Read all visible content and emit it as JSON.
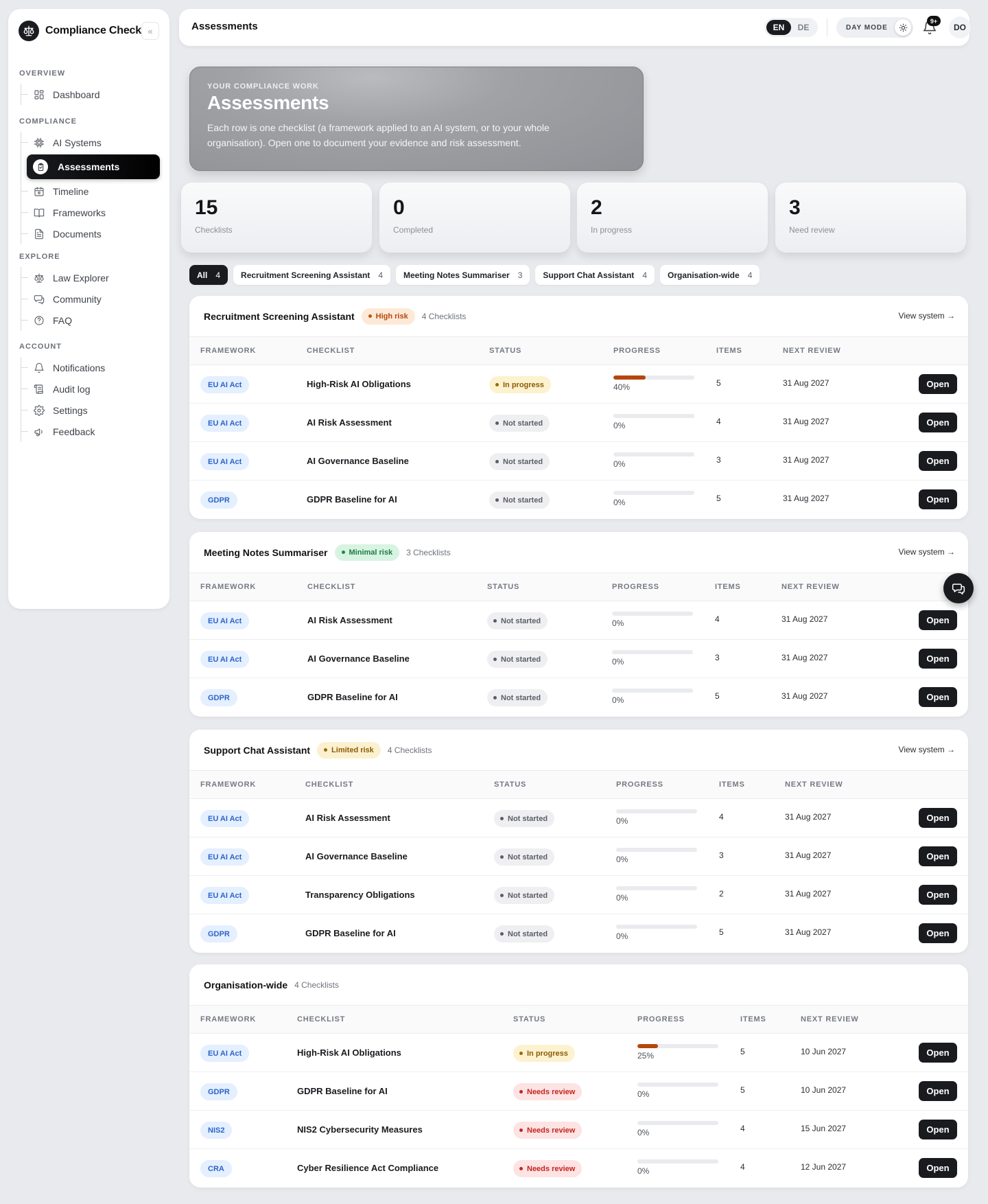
{
  "app": {
    "name": "Compliance Check",
    "collapse_label": "«"
  },
  "nav": {
    "sections": [
      {
        "title": "OVERVIEW",
        "items": [
          {
            "label": "Dashboard",
            "icon": "dashboard-icon"
          }
        ]
      },
      {
        "title": "COMPLIANCE",
        "items": [
          {
            "label": "AI Systems",
            "icon": "chip-icon"
          },
          {
            "label": "Assessments",
            "icon": "clipboard-icon",
            "active": true
          },
          {
            "label": "Timeline",
            "icon": "calendar-icon"
          },
          {
            "label": "Frameworks",
            "icon": "book-icon"
          },
          {
            "label": "Documents",
            "icon": "document-icon"
          }
        ]
      },
      {
        "title": "EXPLORE",
        "items": [
          {
            "label": "Law Explorer",
            "icon": "scales-icon"
          },
          {
            "label": "Community",
            "icon": "chat-icon"
          },
          {
            "label": "FAQ",
            "icon": "help-icon"
          }
        ]
      },
      {
        "title": "ACCOUNT",
        "items": [
          {
            "label": "Notifications",
            "icon": "bell-icon"
          },
          {
            "label": "Audit log",
            "icon": "log-icon"
          },
          {
            "label": "Settings",
            "icon": "gear-icon"
          },
          {
            "label": "Feedback",
            "icon": "megaphone-icon"
          }
        ]
      }
    ]
  },
  "topbar": {
    "title": "Assessments",
    "languages": [
      "EN",
      "DE"
    ],
    "active_language": "EN",
    "mode_label": "DAY MODE",
    "notification_badge": "9+",
    "avatar_initials": "DO"
  },
  "hero": {
    "kicker": "YOUR COMPLIANCE WORK",
    "title": "Assessments",
    "description": "Each row is one checklist (a framework applied to an AI system, or to your whole organisation). Open one to document your evidence and risk assessment."
  },
  "stats": [
    {
      "value": "15",
      "label": "Checklists"
    },
    {
      "value": "0",
      "label": "Completed"
    },
    {
      "value": "2",
      "label": "In progress"
    },
    {
      "value": "3",
      "label": "Need review"
    }
  ],
  "filters": [
    {
      "label": "All",
      "count": "4",
      "active": true
    },
    {
      "label": "Recruitment Screening Assistant",
      "count": "4"
    },
    {
      "label": "Meeting Notes Summariser",
      "count": "3"
    },
    {
      "label": "Support Chat Assistant",
      "count": "4"
    },
    {
      "label": "Organisation-wide",
      "count": "4"
    }
  ],
  "table_headers": {
    "framework": "FRAMEWORK",
    "checklist": "CHECKLIST",
    "status": "STATUS",
    "progress": "PROGRESS",
    "items": "ITEMS",
    "next_review": "NEXT REVIEW"
  },
  "open_label": "Open",
  "view_system_label": "View system →",
  "groups": [
    {
      "name": "Recruitment Screening Assistant",
      "risk": "High risk",
      "risk_level": "high",
      "count": "4 Checklists",
      "view_link": true,
      "rows": [
        {
          "framework": "EU AI Act",
          "checklist": "High-Risk AI Obligations",
          "status": "In progress",
          "status_kind": "inprog",
          "progress": 40,
          "progress_label": "40%",
          "items": "5",
          "next_review": "31 Aug 2027"
        },
        {
          "framework": "EU AI Act",
          "checklist": "AI Risk Assessment",
          "status": "Not started",
          "status_kind": "not",
          "progress": 0,
          "progress_label": "0%",
          "items": "4",
          "next_review": "31 Aug 2027"
        },
        {
          "framework": "EU AI Act",
          "checklist": "AI Governance Baseline",
          "status": "Not started",
          "status_kind": "not",
          "progress": 0,
          "progress_label": "0%",
          "items": "3",
          "next_review": "31 Aug 2027"
        },
        {
          "framework": "GDPR",
          "checklist": "GDPR Baseline for AI",
          "status": "Not started",
          "status_kind": "not",
          "progress": 0,
          "progress_label": "0%",
          "items": "5",
          "next_review": "31 Aug 2027"
        }
      ]
    },
    {
      "name": "Meeting Notes Summariser",
      "risk": "Minimal risk",
      "risk_level": "minimal",
      "count": "3 Checklists",
      "view_link": true,
      "rows": [
        {
          "framework": "EU AI Act",
          "checklist": "AI Risk Assessment",
          "status": "Not started",
          "status_kind": "not",
          "progress": 0,
          "progress_label": "0%",
          "items": "4",
          "next_review": "31 Aug 2027"
        },
        {
          "framework": "EU AI Act",
          "checklist": "AI Governance Baseline",
          "status": "Not started",
          "status_kind": "not",
          "progress": 0,
          "progress_label": "0%",
          "items": "3",
          "next_review": "31 Aug 2027"
        },
        {
          "framework": "GDPR",
          "checklist": "GDPR Baseline for AI",
          "status": "Not started",
          "status_kind": "not",
          "progress": 0,
          "progress_label": "0%",
          "items": "5",
          "next_review": "31 Aug 2027"
        }
      ]
    },
    {
      "name": "Support Chat Assistant",
      "risk": "Limited risk",
      "risk_level": "limited",
      "count": "4 Checklists",
      "view_link": true,
      "rows": [
        {
          "framework": "EU AI Act",
          "checklist": "AI Risk Assessment",
          "status": "Not started",
          "status_kind": "not",
          "progress": 0,
          "progress_label": "0%",
          "items": "4",
          "next_review": "31 Aug 2027"
        },
        {
          "framework": "EU AI Act",
          "checklist": "AI Governance Baseline",
          "status": "Not started",
          "status_kind": "not",
          "progress": 0,
          "progress_label": "0%",
          "items": "3",
          "next_review": "31 Aug 2027"
        },
        {
          "framework": "EU AI Act",
          "checklist": "Transparency Obligations",
          "status": "Not started",
          "status_kind": "not",
          "progress": 0,
          "progress_label": "0%",
          "items": "2",
          "next_review": "31 Aug 2027"
        },
        {
          "framework": "GDPR",
          "checklist": "GDPR Baseline for AI",
          "status": "Not started",
          "status_kind": "not",
          "progress": 0,
          "progress_label": "0%",
          "items": "5",
          "next_review": "31 Aug 2027"
        }
      ]
    },
    {
      "name": "Organisation-wide",
      "risk": "",
      "risk_level": "",
      "count": "4 Checklists",
      "view_link": false,
      "rows": [
        {
          "framework": "EU AI Act",
          "checklist": "High-Risk AI Obligations",
          "status": "In progress",
          "status_kind": "inprog",
          "progress": 25,
          "progress_label": "25%",
          "items": "5",
          "next_review": "10 Jun 2027"
        },
        {
          "framework": "GDPR",
          "checklist": "GDPR Baseline for AI",
          "status": "Needs review",
          "status_kind": "review",
          "progress": 0,
          "progress_label": "0%",
          "items": "5",
          "next_review": "10 Jun 2027"
        },
        {
          "framework": "NIS2",
          "checklist": "NIS2 Cybersecurity Measures",
          "status": "Needs review",
          "status_kind": "review",
          "progress": 0,
          "progress_label": "0%",
          "items": "4",
          "next_review": "15 Jun 2027"
        },
        {
          "framework": "CRA",
          "checklist": "Cyber Resilience Act Compliance",
          "status": "Needs review",
          "status_kind": "review",
          "progress": 0,
          "progress_label": "0%",
          "items": "4",
          "next_review": "12 Jun 2027"
        }
      ]
    }
  ],
  "colors": {
    "accent": "#1a1b1f",
    "progress": "#b5470e",
    "framework_badge": "#e4efff"
  }
}
